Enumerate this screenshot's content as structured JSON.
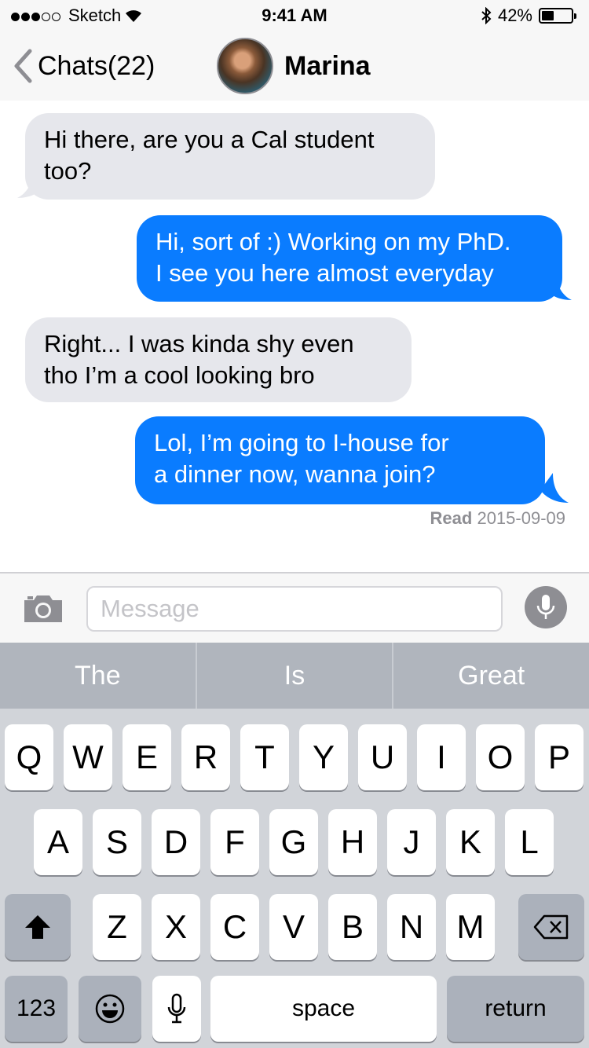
{
  "status_bar": {
    "carrier": "Sketch",
    "time": "9:41 AM",
    "battery": "42%",
    "battery_level": 0.42
  },
  "nav": {
    "back_label": "Chats(22)",
    "contact_name": "Marina"
  },
  "messages": [
    {
      "direction": "incoming",
      "text_lines": [
        "Hi there, are you a Cal student",
        "too?"
      ]
    },
    {
      "direction": "outgoing",
      "text_lines": [
        "Hi, sort of :) Working on my PhD.",
        "I see you here almost everyday"
      ]
    },
    {
      "direction": "incoming",
      "text_lines": [
        "Right... I was kinda shy even",
        "tho I’m a cool looking bro"
      ]
    },
    {
      "direction": "outgoing",
      "text_lines": [
        "Lol, I’m going to I-house for",
        "a dinner now, wanna join?"
      ]
    }
  ],
  "read_receipt": {
    "label": "Read",
    "date": "2015-09-09"
  },
  "input": {
    "placeholder": "Message"
  },
  "suggestions": [
    "The",
    "Is",
    "Great"
  ],
  "keyboard": {
    "row1": [
      "Q",
      "W",
      "E",
      "R",
      "T",
      "Y",
      "U",
      "I",
      "O",
      "P"
    ],
    "row2": [
      "A",
      "S",
      "D",
      "F",
      "G",
      "H",
      "J",
      "K",
      "L"
    ],
    "row3": [
      "Z",
      "X",
      "C",
      "V",
      "B",
      "N",
      "M"
    ],
    "numbers_label": "123",
    "space_label": "space",
    "return_label": "return"
  },
  "colors": {
    "outgoing_bubble": "#0a7cff",
    "incoming_bubble": "#e6e7ec",
    "keyboard_bg": "#d1d4d9",
    "suggestion_bar": "#b0b5bd"
  },
  "icons": [
    "signal-dots-icon",
    "wifi-icon",
    "bluetooth-icon",
    "battery-icon",
    "chevron-left-icon",
    "camera-icon",
    "microphone-icon",
    "shift-icon",
    "backspace-icon",
    "emoji-icon",
    "dictation-icon"
  ]
}
